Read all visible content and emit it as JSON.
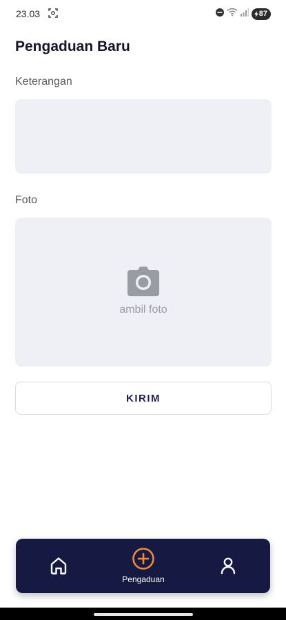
{
  "status_bar": {
    "time": "23.03",
    "battery": "87",
    "icons": [
      "screenshot-icon",
      "do-not-disturb-icon",
      "wifi-icon",
      "signal-icon",
      "battery-icon"
    ]
  },
  "page": {
    "title": "Pengaduan Baru"
  },
  "form": {
    "description_label": "Keterangan",
    "description_value": "",
    "photo_label": "Foto",
    "photo_placeholder": "ambil foto",
    "submit_label": "KIRIM"
  },
  "bottom_nav": {
    "items": [
      {
        "icon": "home-icon",
        "label": ""
      },
      {
        "icon": "add-circle-icon",
        "label": "Pengaduan",
        "active": true
      },
      {
        "icon": "profile-icon",
        "label": ""
      }
    ],
    "active_color": "#f08a3c",
    "background": "#161a42"
  },
  "colors": {
    "accent": "#1d2159",
    "field_background": "#eef0f5"
  }
}
